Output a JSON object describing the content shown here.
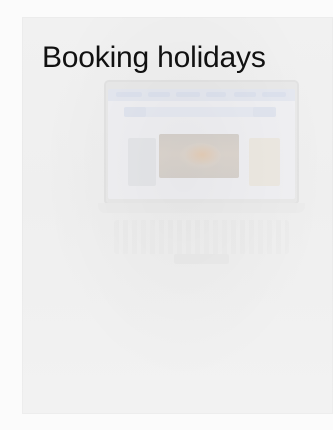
{
  "title": "Booking holidays",
  "colors": {
    "background": "#fbfbfb",
    "title_text": "#111111"
  }
}
